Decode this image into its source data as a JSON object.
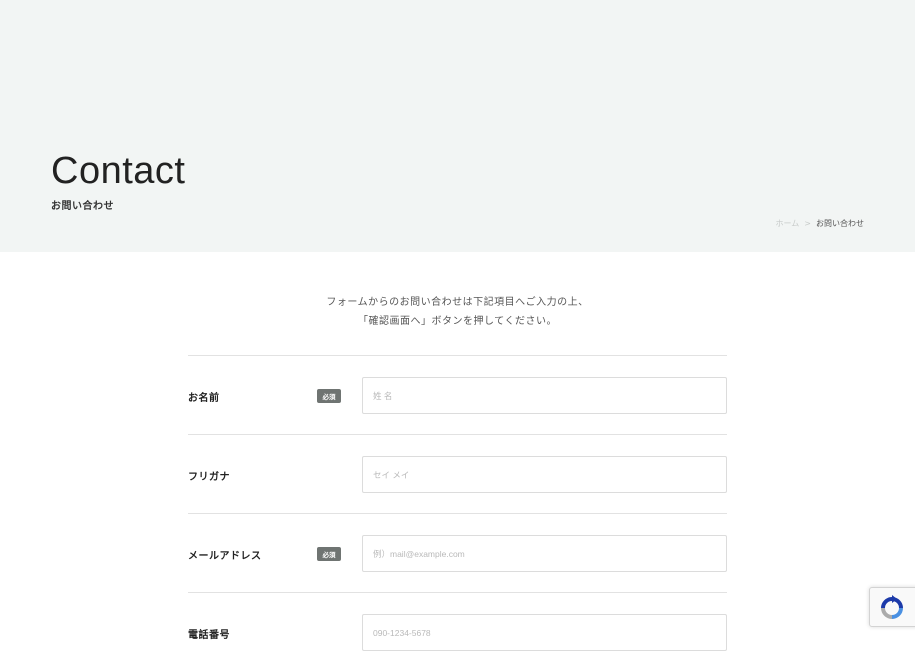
{
  "header": {
    "title": "Contact",
    "subtitle": "お問い合わせ"
  },
  "breadcrumb": {
    "home": "ホーム",
    "separator": ">",
    "current": "お問い合わせ"
  },
  "intro": {
    "line1": "フォームからのお問い合わせは下記項目へご入力の上、",
    "line2": "「確認画面へ」ボタンを押してください。"
  },
  "form": {
    "required_label": "必須",
    "fields": [
      {
        "label": "お名前",
        "required": true,
        "placeholder": "姓 名",
        "value": ""
      },
      {
        "label": "フリガナ",
        "required": false,
        "placeholder": "セイ メイ",
        "value": ""
      },
      {
        "label": "メールアドレス",
        "required": true,
        "placeholder": "例）mail@example.com",
        "value": ""
      },
      {
        "label": "電話番号",
        "required": false,
        "placeholder": "090-1234-5678",
        "value": ""
      }
    ]
  },
  "recaptcha": {
    "icon": "recaptcha-icon"
  },
  "colors": {
    "hero_bg": "#f2f5f4",
    "badge_bg": "#6f7472",
    "border": "#dcdcdc"
  }
}
